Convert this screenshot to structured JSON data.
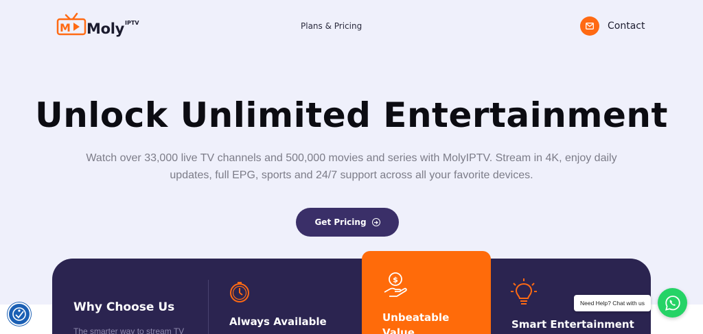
{
  "header": {
    "logo_text": "Moly",
    "logo_sup": "IPTV",
    "nav_link": "Plans & Pricing",
    "contact_label": "Contact"
  },
  "hero": {
    "title": "Unlock Unlimited Entertainment",
    "subtitle": "Watch over 33,000 live TV channels and 500,000 movies and series with MolyIPTV. Stream in 4K, enjoy daily updates, full EPG, sports and 24/7 support across all your favorite devices.",
    "cta_label": "Get Pricing"
  },
  "features": {
    "why_title": "Why Choose Us",
    "why_subtitle": "The smarter way to stream TV",
    "items": [
      {
        "label": "Always Available",
        "icon": "clock-icon"
      },
      {
        "label": "Unbeatable Value",
        "icon": "money-hand-icon"
      },
      {
        "label": "Smart Entertainment",
        "icon": "lightbulb-icon"
      }
    ]
  },
  "widgets": {
    "help_text": "Need Help? Chat with us"
  },
  "colors": {
    "accent": "#ff6a13",
    "brand_dark": "#2b2450",
    "cta": "#3a2f68",
    "whatsapp": "#25d366"
  }
}
